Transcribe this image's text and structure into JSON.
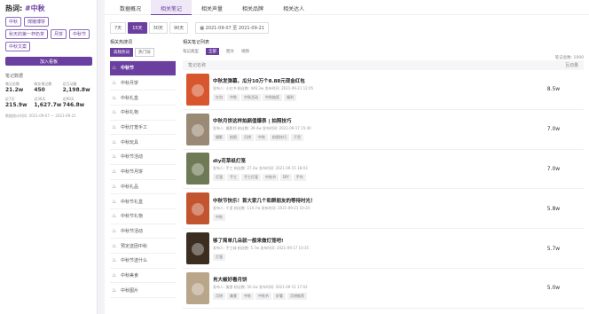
{
  "sidebar": {
    "hot_prefix": "热词: ",
    "hot_word": "#中秋",
    "chips": [
      "中秋",
      "嫦娥博饼",
      "秋天的第一杯奶茶",
      "月饼",
      "中秋节",
      "中秋文案"
    ],
    "add_btn": "加入看板",
    "stats_title": "笔记数据",
    "stats": [
      {
        "label": "笔记总数",
        "value": "21.2w"
      },
      {
        "label": "商业笔记数",
        "value": "450"
      },
      {
        "label": "总互动量",
        "value": "2,198.8w"
      },
      {
        "label": "近7天",
        "value": "215.9w"
      },
      {
        "label": "近30天",
        "value": "1,627.7w"
      },
      {
        "label": "近90天",
        "value": "746.8w"
      }
    ],
    "time_label": "数据统计时间: 2021-09-07 — 2021-09-21"
  },
  "tabs": [
    "数据概况",
    "相关笔记",
    "相关声量",
    "相关品牌",
    "相关达人"
  ],
  "active_tab": 1,
  "filters": {
    "ranges": [
      "7天",
      "15天",
      "30天",
      "90天"
    ],
    "active_range": 1,
    "date_range": "2021-09-07 至 2021-09-21"
  },
  "keywords": {
    "title": "相关热搜词",
    "subtabs": [
      "高频热词",
      "热门词"
    ],
    "items": [
      "中秋节",
      "中秋月饼",
      "中秋礼盒",
      "中秋礼物",
      "中秋灯笼手工",
      "中秋玩具",
      "中秋节活动",
      "中秋节月饼",
      "中秋礼品",
      "中秋节礼盒",
      "中秋节礼物",
      "中秋节活动",
      "预定送团中秋",
      "中秋节送什么",
      "中秋美食",
      "中秋图片"
    ]
  },
  "notes": {
    "title": "相关笔记列表",
    "subtabs": [
      "笔记类型",
      "全部",
      "图文",
      "视频"
    ],
    "total": "笔记总数: 1000",
    "col_name": "笔记名称",
    "col_metric": "互动量",
    "rows": [
      {
        "title": "中秋发弹幕，瓜分10万个8.88元现金红包",
        "meta": "发布人: 小红书  粉丝数: 446.3w  发布时间: 2021-09-21 12:05",
        "tags": [
          "红包",
          "中秋",
          "中秋活动",
          "中秋抽奖",
          "福利"
        ],
        "value": "8.5w",
        "color": "#d8562d"
      },
      {
        "title": "中秋月饼这样拍颜值爆表 | 拍照技巧",
        "meta": "发布人: 摄影师  粉丝数: 39.4w  发布时间: 2021-09-17 15:40",
        "tags": [
          "摄影",
          "拍照",
          "月饼",
          "中秋",
          "拍照技巧",
          "干货"
        ],
        "value": "7.0w",
        "color": "#9a8a75"
      },
      {
        "title": "diy花草纸灯笼",
        "meta": "发布人: 手工  粉丝数: 27.2w  发布时间: 2021-09-15 18:03",
        "tags": [
          "灯笼",
          "手工",
          "手工灯笼",
          "中秋节",
          "DIY",
          "手作"
        ],
        "value": "7.0w",
        "color": "#6d7a55"
      },
      {
        "title": "中秋节快乐！首大家几个和群朋友的等待时光！",
        "meta": "发布人: 千里  粉丝数: 110.7w  发布时间: 2021-09-21 10:24",
        "tags": [
          "中秋"
        ],
        "value": "5.8w",
        "color": "#c25530"
      },
      {
        "title": "够了简单几朵就一般来做灯笼吧!",
        "meta": "发布人: 手工妹  粉丝数: 5.7w  发布时间: 2021-09-17 10:35",
        "tags": [
          "灯笼"
        ],
        "value": "5.7w",
        "color": "#3b2e20"
      },
      {
        "title": "肖大椒好看月饼",
        "meta": "发布人: 美食  粉丝数: 50.2w  发布时间: 2021-09-11 17:02",
        "tags": [
          "月饼",
          "美食",
          "中秋",
          "中秋节",
          "好看",
          "月饼推荐"
        ],
        "value": "5.0w",
        "color": "#b8a58a"
      }
    ]
  }
}
